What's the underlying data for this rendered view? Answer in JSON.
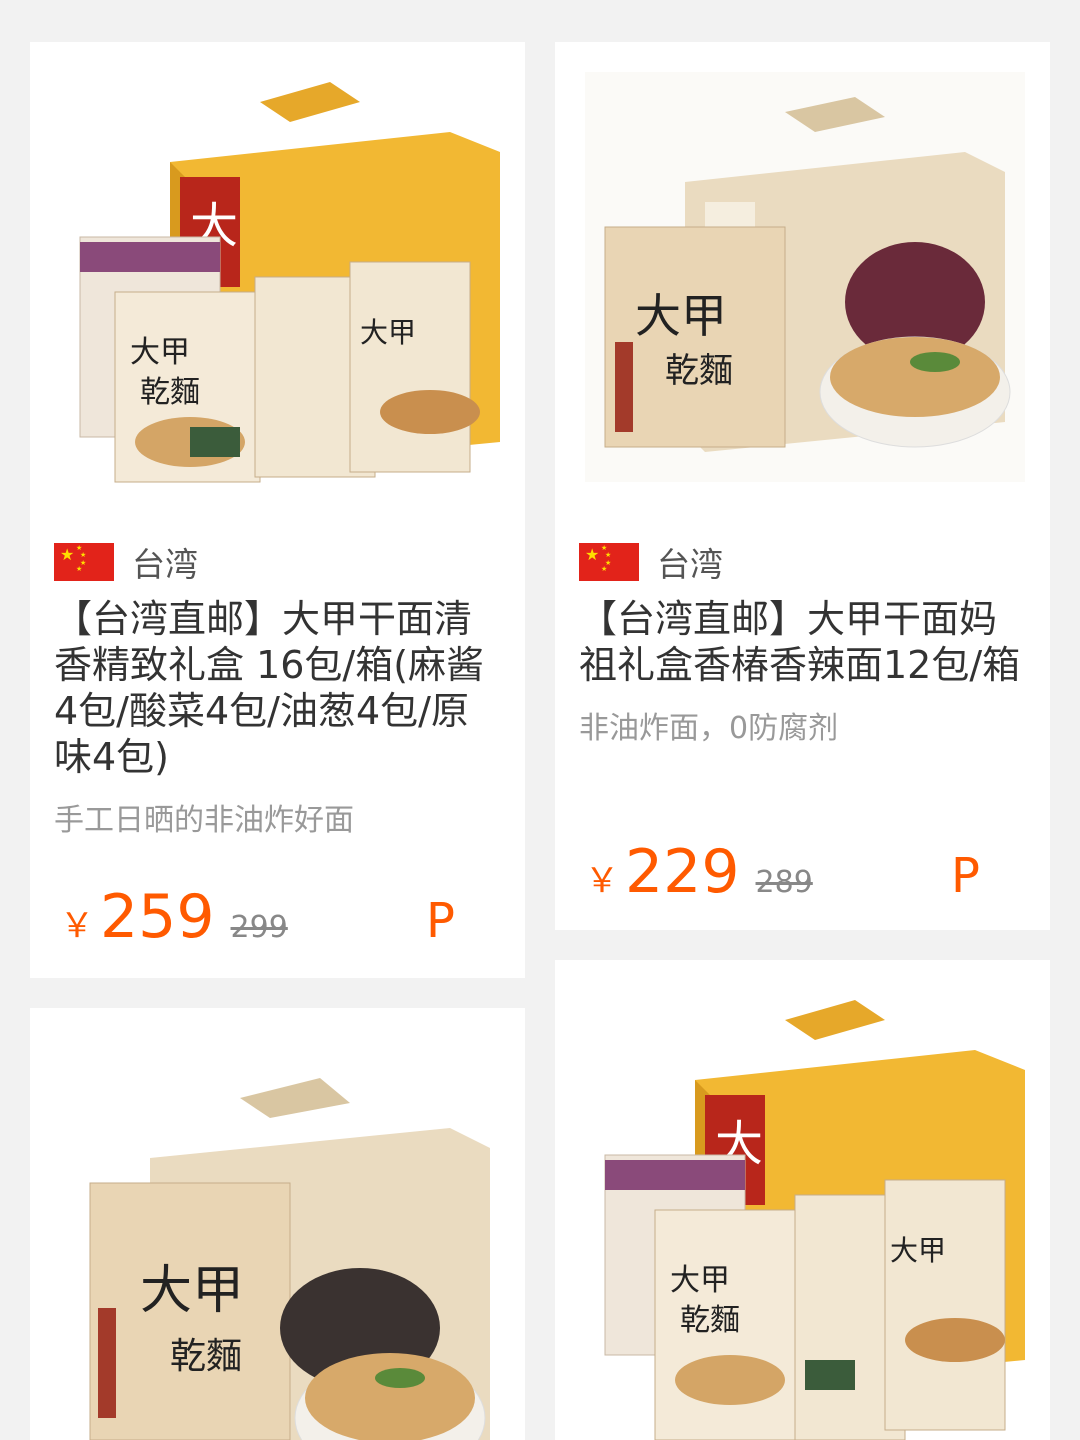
{
  "colors": {
    "background": "#f2f2f2",
    "card": "#ffffff",
    "price": "#ff5a00",
    "flag_red": "#e2231a",
    "flag_star": "#ffde00"
  },
  "products": [
    {
      "origin": "台湾",
      "title": "【台湾直邮】大甲干面清香精致礼盒 16包/箱(麻酱4包/酸菜4包/油葱4包/原味4包)",
      "subtitle": "手工日晒的非油炸好面",
      "currency": "￥",
      "price": "259",
      "original_price": "299",
      "badge": "P",
      "image_icon": "noodle-gift-box-yellow-image"
    },
    {
      "origin": "台湾",
      "title": "【台湾直邮】大甲干面妈祖礼盒香椿香辣面12包/箱",
      "subtitle": "非油炸面，0防腐剂",
      "currency": "￥",
      "price": "229",
      "original_price": "289",
      "badge": "P",
      "image_icon": "noodle-gift-box-beige-image"
    },
    {
      "image_icon": "noodle-gift-box-beige-bowl-image"
    },
    {
      "image_icon": "noodle-gift-box-yellow-image"
    }
  ]
}
